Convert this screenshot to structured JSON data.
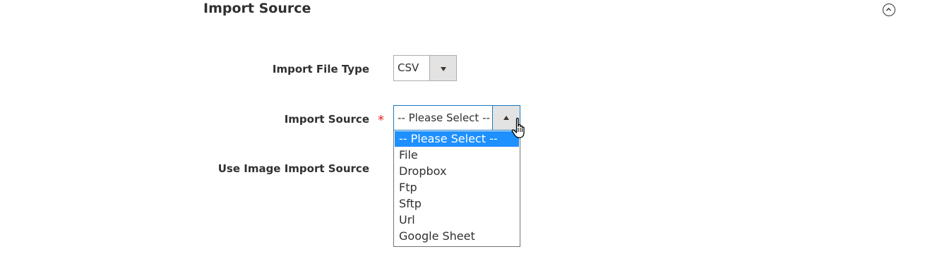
{
  "section": {
    "title": "Import Source",
    "collapse_icon": "chevron-up-circle-icon"
  },
  "fields": {
    "import_file_type": {
      "label": "Import File Type",
      "value": "CSV",
      "arrow_icon": "caret-down-icon"
    },
    "import_source": {
      "label": "Import Source",
      "required_mark": "*",
      "value": "-- Please Select --",
      "arrow_icon": "caret-up-icon",
      "options": [
        "-- Please Select --",
        "File",
        "Dropbox",
        "Ftp",
        "Sftp",
        "Url",
        "Google Sheet"
      ],
      "highlighted_option": "-- Please Select --"
    },
    "use_image_import_source": {
      "label": "Use Image Import Source"
    }
  },
  "colors": {
    "required": "#e22626",
    "focus_border": "#1979c3",
    "highlight": "#1e90ff",
    "text": "#303030"
  },
  "cursor": "hand-pointer-icon"
}
